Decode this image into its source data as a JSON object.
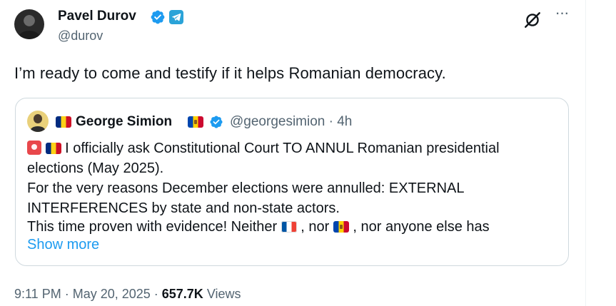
{
  "author": {
    "name": "Pavel Durov",
    "handle": "@durov"
  },
  "tweet": {
    "text": "I’m ready to come and testify if it helps Romanian democracy."
  },
  "quote": {
    "name": "George Simion",
    "handle_time": "@georgesimion · 4h",
    "lines": [
      " I officially ask Constitutional Court TO ANNUL Romanian presidential",
      "elections (May 2025).",
      "For the very reasons December elections were annulled: EXTERNAL",
      "INTERFERENCES by state and non-state actors.",
      "This time proven with evidence! Neither ",
      ", nor ",
      ", nor anyone else has"
    ],
    "show_more": "Show more"
  },
  "meta": {
    "time_date": "9:11 PM · May 20, 2025 · ",
    "views_count": "657.7K",
    "views_label": " Views"
  },
  "icons": {
    "verified": "verified-badge-icon",
    "telegram": "telegram-icon",
    "grok": "grok-icon",
    "more": "more-horizontal-icon",
    "siren": "police-light-emoji",
    "flags": [
      "romania-flag",
      "moldova-flag",
      "france-flag"
    ]
  },
  "colors": {
    "accent": "#1d9bf0",
    "text": "#0f1419",
    "secondary": "#536471",
    "border": "#cfd9de"
  }
}
